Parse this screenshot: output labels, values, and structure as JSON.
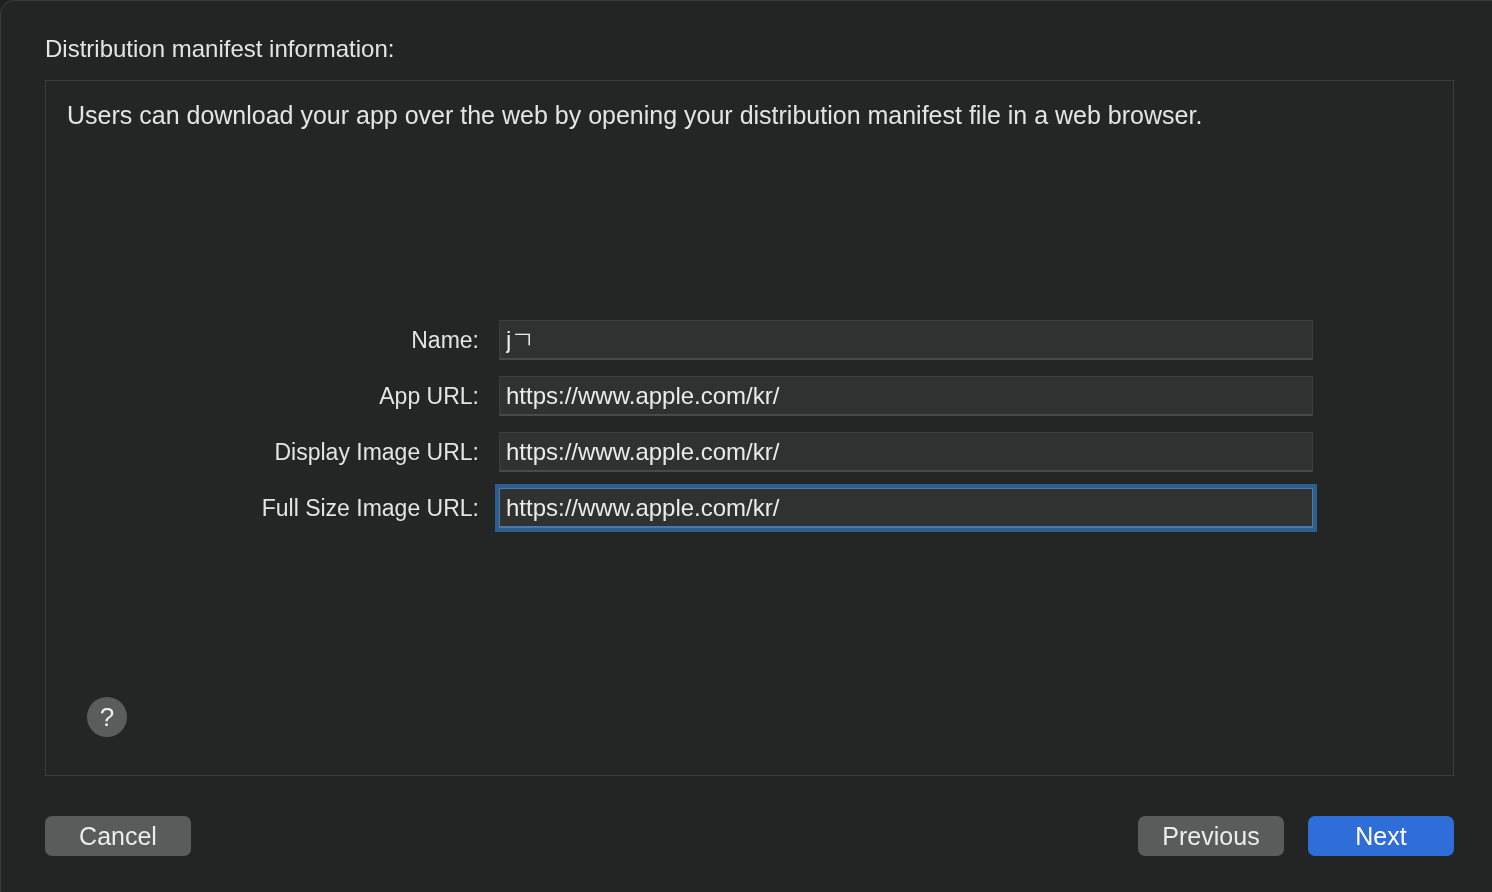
{
  "heading": "Distribution manifest information:",
  "description": "Users can download your app over the web by opening your distribution manifest file in a web browser.",
  "fields": [
    {
      "label": "Name:",
      "value": "jㄱ",
      "focused": false
    },
    {
      "label": "App URL:",
      "value": "https://www.apple.com/kr/",
      "focused": false
    },
    {
      "label": "Display Image URL:",
      "value": "https://www.apple.com/kr/",
      "focused": false
    },
    {
      "label": "Full Size Image URL:",
      "value": "https://www.apple.com/kr/",
      "focused": true
    }
  ],
  "help_button": {
    "label": "?"
  },
  "buttons_left": [
    {
      "label": "Cancel",
      "kind": "default"
    }
  ],
  "buttons_right": [
    {
      "label": "Previous",
      "kind": "default"
    },
    {
      "label": "Next",
      "kind": "primary"
    }
  ]
}
